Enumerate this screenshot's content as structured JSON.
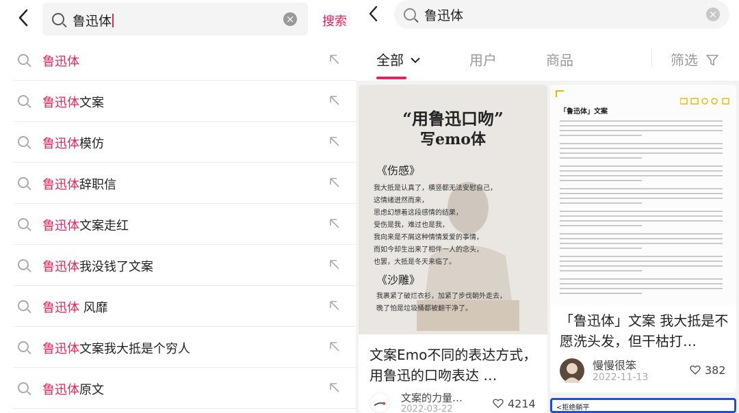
{
  "left": {
    "query": "鲁迅体",
    "search_button": "搜索",
    "suggestions": [
      {
        "highlight": "鲁迅体",
        "rest": ""
      },
      {
        "highlight": "鲁迅体",
        "rest": "文案"
      },
      {
        "highlight": "鲁迅体",
        "rest": "模仿"
      },
      {
        "highlight": "鲁迅体",
        "rest": "辞职信"
      },
      {
        "highlight": "鲁迅体",
        "rest": "文案走红"
      },
      {
        "highlight": "鲁迅体",
        "rest": "我没钱了文案"
      },
      {
        "highlight": "鲁迅体",
        "rest": " 风靡"
      },
      {
        "highlight": "鲁迅体",
        "rest": "文案我大抵是个穷人"
      },
      {
        "highlight": "鲁迅体",
        "rest": "原文"
      }
    ]
  },
  "right": {
    "query": "鲁迅体",
    "tabs": [
      "全部",
      "用户",
      "商品"
    ],
    "filter_label": "筛选",
    "cards": [
      {
        "poster_title_1": "“用鲁迅口吻”",
        "poster_title_2": "写emo体",
        "poster_section_1": "《伤感》",
        "poster_lines_1": [
          "我大抵是认真了，横竖都无法安慰自己，",
          "这情绪迸然而来，",
          "思虑幻想着这段感情的结果，",
          "受伤是我，难过也是我，",
          "我向来是不屑这种情情爱爱的事情，",
          "而如今却生出来了相伴一人的念头，",
          "也罢，大抵是冬天来临了。"
        ],
        "poster_section_2": "《沙雕》",
        "poster_lines_2": [
          "我裹紧了破烂衣衫，加紧了步伐朝外走去，",
          "晚了怕是垃圾桶都被翻干净了。"
        ],
        "title": "文案Emo不同的表达方式，用鲁迅的口吻表达 …",
        "author": "文案的力量…",
        "date": "2022-03-22",
        "likes": "4214"
      },
      {
        "doc_heading": "「鲁迅体」文案",
        "title": "「鲁迅体」文案 我大抵是不愿洗头发，但干枯打…",
        "author": "慢慢很笨",
        "date": "2022-11-13",
        "likes": "382"
      }
    ],
    "next_card_label": "<拒绝躺平"
  },
  "colors": {
    "accent": "#e1245a",
    "highlight_text": "#e1245a",
    "next_card_border": "#1d4fd6"
  },
  "icons": [
    "back-arrow-icon",
    "search-icon",
    "clear-icon",
    "fill-arrow-icon",
    "chevron-down-icon",
    "filter-icon",
    "heart-icon"
  ]
}
